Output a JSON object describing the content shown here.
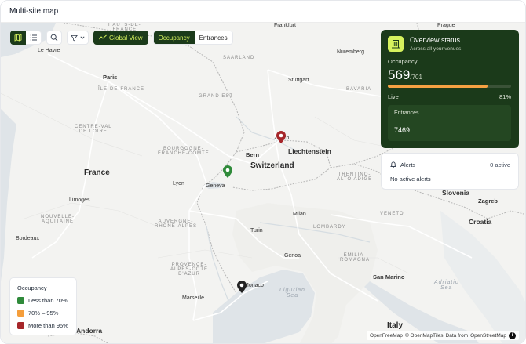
{
  "window": {
    "title": "Multi-site map"
  },
  "toolbar": {
    "map_view_icon": "map-icon",
    "list_view_icon": "list-icon",
    "search_icon": "search-icon",
    "filter_icon": "filter-icon",
    "global_view_label": "Global View",
    "segment": {
      "occupancy": "Occupancy",
      "entrances": "Entrances",
      "active": "occupancy"
    }
  },
  "map": {
    "labels": {
      "haut_de_france": "HAUTS-DE-\nFRANCE",
      "frankfurt": "Frankfurt",
      "prague": "Prague",
      "le_havre": "Le Havre",
      "saarland": "SAARLAND",
      "nuremberg": "Nuremberg",
      "paris": "Paris",
      "ile_de_france": "ÎLE-DE-FRANCE",
      "stuttgart": "Stuttgart",
      "bavaria": "BAVARIA",
      "grand_est": "GRAND EST",
      "centre_loire": "CENTRE-VAL\nDE LOIRE",
      "zurich": "Zurich",
      "bern": "Bern",
      "liechtenstein": "Liechtenstein",
      "switzerland": "Switzerland",
      "bourgogne": "BOURGOGNE-\nFRANCHE-COMTÉ",
      "france": "France",
      "geneva": "Geneva",
      "lyon": "Lyon",
      "trentino": "TRENTINO-\nALTO ADIGE",
      "slovenia": "Slovenia",
      "limoges": "Limoges",
      "milan": "Milan",
      "veneto": "VENETO",
      "zagreb": "Zagreb",
      "nouvelle": "NOUVELLE-\nAQUITAINE",
      "auvergne": "AUVERGNE-\nRHÔNE-ALPES",
      "lombardy": "LOMBARDY",
      "croatia": "Croatia",
      "bordeaux": "Bordeaux",
      "turin": "Turin",
      "genoa": "Genoa",
      "emilia": "EMILIA-\nROMAGNA",
      "provence": "PROVENCE-\nALPES-CÔTE\nD'AZUR",
      "san_marino": "San Marino",
      "adriatic": "Adriatic\nSea",
      "monaco": "Monaco",
      "ligurian": "Ligurian\nSea",
      "marseille": "Marseille",
      "andorra": "Andorra",
      "italy": "Italy"
    },
    "attribution": {
      "openfreemap": "OpenFreeMap",
      "copyright": "© OpenMapTiles",
      "data_from": "Data from",
      "osm": "OpenStreetMap",
      "info_icon": "info-icon"
    }
  },
  "markers": [
    {
      "name": "marker-zurich",
      "status": "more-than-95",
      "color": "#a6262a"
    },
    {
      "name": "marker-geneva",
      "status": "less-than-70",
      "color": "#2f8a3a"
    },
    {
      "name": "marker-monaco",
      "status": "unknown",
      "color": "#222222"
    }
  ],
  "overview": {
    "icon": "building-icon",
    "title": "Overview status",
    "subtitle": "Across all your venues",
    "occupancy_label": "Occupancy",
    "occupancy_value": "569",
    "occupancy_capacity": "/701",
    "occupancy_fraction": 0.81,
    "live_label": "Live",
    "percent_label": "81%",
    "entrances_label": "Entrances",
    "entrances_value": "7469",
    "bar_color": "#f5a142"
  },
  "alerts": {
    "icon": "bell-icon",
    "title": "Alerts",
    "count": "0 active",
    "message": "No active alerts"
  },
  "legend": {
    "title": "Occupancy",
    "items": [
      {
        "label": "Less than 70%",
        "color": "#2f8a3a"
      },
      {
        "label": "70% – 95%",
        "color": "#f59e3b"
      },
      {
        "label": "More than 95%",
        "color": "#a6262a"
      }
    ]
  },
  "colors": {
    "accent": "#1b3a1a",
    "accent_text": "#d6f25e"
  }
}
